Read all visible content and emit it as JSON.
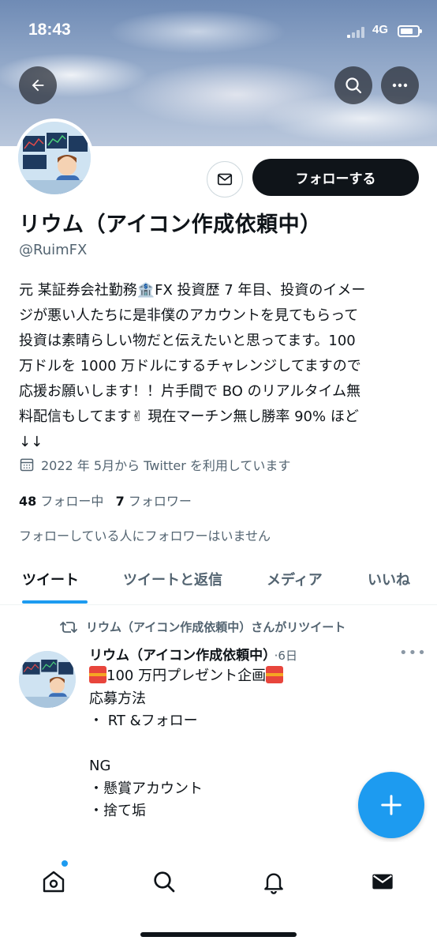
{
  "status_bar": {
    "time": "18:43",
    "network": "4G"
  },
  "profile": {
    "display_name": "リウム（アイコン作成依頼中）",
    "handle": "@RuimFX",
    "follow_label": "フォローする",
    "bio": "元 某証券会社勤務🏦FX 投資歴 7 年目、投資のイメー\nジが悪い人たちに是非僕のアカウントを見てもらって\n投資は素晴らしい物だと伝えたいと思ってます。100\n万ドルを 1000 万ドルにするチャレンジしてますので\n応援お願いします！！片手間で BO のリアルタイム無\n料配信もしてます✌ 現在マーチン無し勝率 90% ほど\n↓↓",
    "joined": "2022 年 5月から Twitter を利用しています",
    "following_count": "48",
    "following_label": "フォロー中",
    "followers_count": "7",
    "followers_label": "フォロワー",
    "followers_note": "フォローしている人にフォロワーはいません"
  },
  "tabs": [
    {
      "label": "ツイート",
      "active": true
    },
    {
      "label": "ツイートと返信",
      "active": false
    },
    {
      "label": "メディア",
      "active": false
    },
    {
      "label": "いいね",
      "active": false
    }
  ],
  "tweet": {
    "retweet_note": "リウム（アイコン作成依頼中）さんがリツイート",
    "author": "リウム（アイコン作成依頼中）",
    "ago": "·6日",
    "line1": "100 万円プレゼント企画",
    "body": "\n応募方法\n・ RT &フォロー\n\nNG\n・懸賞アカウント\n・捨て垢"
  },
  "colors": {
    "accent": "#1d9bf0",
    "text": "#0f1419",
    "muted": "#536471"
  },
  "icons": {
    "back": "arrow-left-icon",
    "search": "search-icon",
    "more": "more-icon",
    "message": "mail-icon",
    "calendar": "calendar-icon",
    "retweet": "retweet-icon",
    "compose": "plus-icon",
    "nav": [
      "home-icon",
      "search-icon",
      "bell-icon",
      "mail-icon"
    ]
  }
}
